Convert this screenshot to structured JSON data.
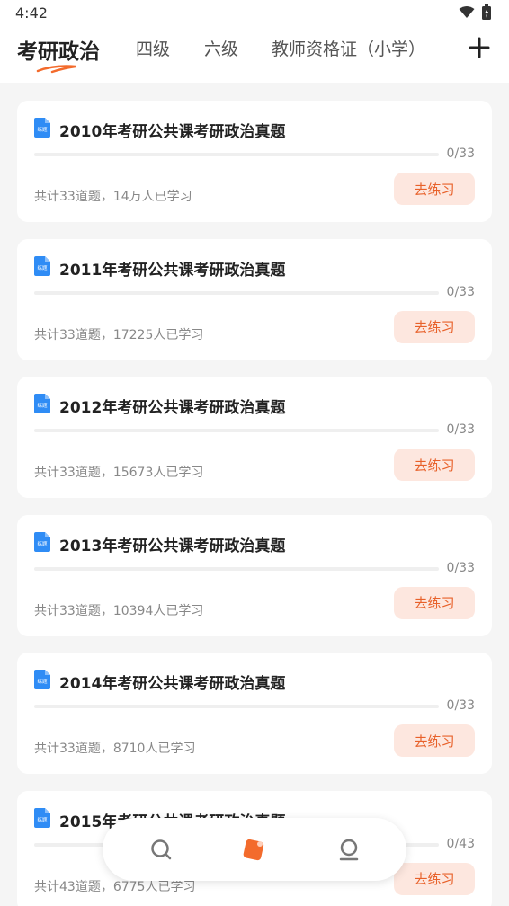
{
  "status_bar": {
    "time": "4:42"
  },
  "header": {
    "tabs": [
      {
        "label": "考研政治",
        "active": true
      },
      {
        "label": "四级"
      },
      {
        "label": "六级"
      },
      {
        "label": "教师资格证（小学）"
      }
    ]
  },
  "cards": [
    {
      "title": "2010年考研公共课考研政治真题",
      "progress": "0/33",
      "meta": "共计33道题，14万人已学习",
      "button": "去练习",
      "progress_ratio": 0
    },
    {
      "title": "2011年考研公共课考研政治真题",
      "progress": "0/33",
      "meta": "共计33道题，17225人已学习",
      "button": "去练习",
      "progress_ratio": 0
    },
    {
      "title": "2012年考研公共课考研政治真题",
      "progress": "0/33",
      "meta": "共计33道题，15673人已学习",
      "button": "去练习",
      "progress_ratio": 0
    },
    {
      "title": "2013年考研公共课考研政治真题",
      "progress": "0/33",
      "meta": "共计33道题，10394人已学习",
      "button": "去练习",
      "progress_ratio": 0
    },
    {
      "title": "2014年考研公共课考研政治真题",
      "progress": "0/33",
      "meta": "共计33道题，8710人已学习",
      "button": "去练习",
      "progress_ratio": 0
    },
    {
      "title": "2015年考研公共课考研政治真题",
      "progress": "0/43",
      "meta": "共计43道题，6775人已学习",
      "button": "去练习",
      "progress_ratio": 0
    }
  ],
  "icon_label": "练题",
  "bottom_nav": {
    "items": [
      {
        "icon": "search-icon"
      },
      {
        "icon": "practice-icon",
        "active": true
      },
      {
        "icon": "profile-icon"
      }
    ]
  },
  "colors": {
    "accent": "#f36b2c",
    "button_bg": "#fde7df",
    "button_text": "#e8612a",
    "doc_icon": "#2f8cf5"
  }
}
